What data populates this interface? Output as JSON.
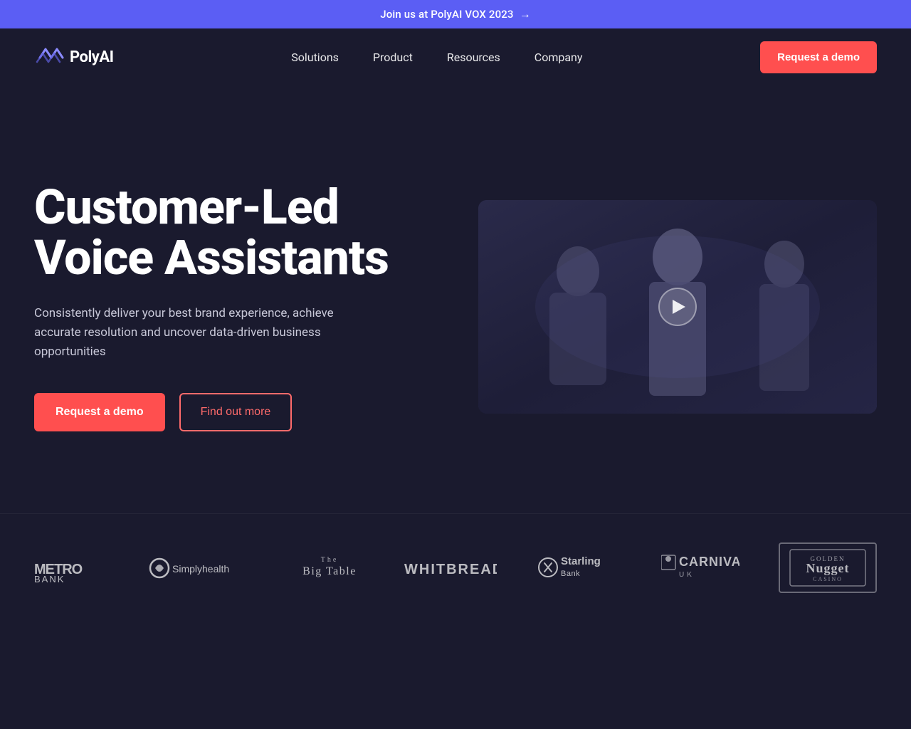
{
  "banner": {
    "text": "Join us at PolyAI VOX 2023",
    "arrow": "→"
  },
  "navbar": {
    "logo_text": "PolyAI",
    "links": [
      {
        "label": "Solutions",
        "id": "solutions"
      },
      {
        "label": "Product",
        "id": "product"
      },
      {
        "label": "Resources",
        "id": "resources"
      },
      {
        "label": "Company",
        "id": "company"
      }
    ],
    "cta_label": "Request a demo"
  },
  "hero": {
    "title_line1": "Customer-Led",
    "title_line2": "Voice Assistants",
    "subtitle": "Consistently deliver your best brand experience, achieve accurate resolution and uncover data-driven business opportunities",
    "btn_primary": "Request a demo",
    "btn_secondary": "Find out more"
  },
  "partners": [
    {
      "name": "Metro Bank",
      "id": "metro-bank"
    },
    {
      "name": "Simplyhealth",
      "id": "simplyhealth"
    },
    {
      "name": "The Big Table",
      "id": "big-table"
    },
    {
      "name": "Whitbread",
      "id": "whitbread"
    },
    {
      "name": "Starling Bank",
      "id": "starling-bank"
    },
    {
      "name": "Carnival UK",
      "id": "carnival-uk"
    },
    {
      "name": "Golden Nugget",
      "id": "golden-nugget"
    }
  ],
  "colors": {
    "banner_bg": "#5b5ef4",
    "body_bg": "#1a1a2e",
    "cta_red": "#ff4f4f",
    "text_muted": "#c8c8d8"
  }
}
